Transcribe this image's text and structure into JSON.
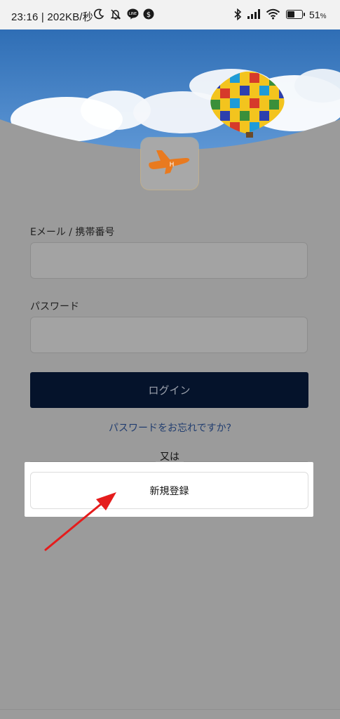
{
  "status_bar": {
    "time": "23:16 | 202KB/秒",
    "battery_percent_number": "51",
    "battery_percent_sign": "%",
    "icons": [
      "moon-icon",
      "bell-off-icon",
      "line-app-icon",
      "dollar-coin-icon",
      "bluetooth-icon",
      "cellular-signal-icon",
      "wifi-icon",
      "battery-icon"
    ]
  },
  "login_form": {
    "email_label": "Eメール / 携帯番号",
    "email_value": "",
    "password_label": "パスワード",
    "password_value": "",
    "login_button_label": "ログイン",
    "forgot_password_link": "パスワードをお忘れですか?",
    "divider_text": "又は",
    "signup_button_label": "新規登録"
  },
  "colors": {
    "login_button": "#05132b",
    "link": "#223e70",
    "highlight_arrow": "#e51c1c",
    "overlay": "#9b9b9b"
  }
}
